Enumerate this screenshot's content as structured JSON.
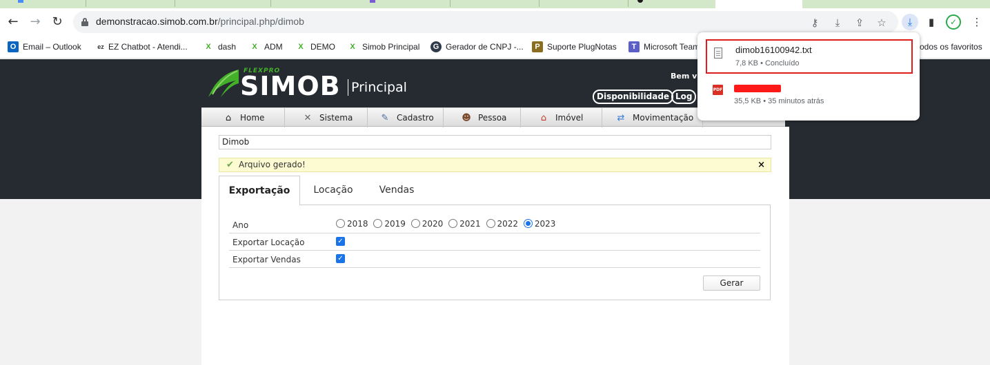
{
  "browser": {
    "url_host": "demonstracao.simob.com.br",
    "url_path": "/principal.php/dimob",
    "icons": [
      "back-icon",
      "forward-icon",
      "reload-icon",
      "lock-icon",
      "key-icon",
      "install-icon",
      "share-icon",
      "star-icon",
      "download-icon",
      "sidebar-icon",
      "menu-icon"
    ]
  },
  "bookmarks": [
    {
      "label": "Email – Outlook",
      "icon": "O"
    },
    {
      "label": "EZ Chatbot - Atendi...",
      "icon": "ez"
    },
    {
      "label": "dash",
      "icon": "X"
    },
    {
      "label": "ADM",
      "icon": "X"
    },
    {
      "label": "DEMO",
      "icon": "X"
    },
    {
      "label": "Simob Principal",
      "icon": "X"
    },
    {
      "label": "Gerador de CNPJ -...",
      "icon": "G"
    },
    {
      "label": "Suporte PlugNotas",
      "icon": "P"
    },
    {
      "label": "Microsoft Team",
      "icon": "T"
    },
    {
      "label": "odos os favoritos",
      "icon": ""
    }
  ],
  "downloads": [
    {
      "name": "dimob16100942.txt",
      "meta": "7,8 KB • Concluído",
      "type": "txt"
    },
    {
      "name": "",
      "meta": "35,5 KB • 35 minutos atrás",
      "type": "pdf"
    }
  ],
  "header": {
    "logo_tagline": "FLEXPRO",
    "logo_name": "SIMOB",
    "logo_section": "Principal",
    "welcome": "Bem v",
    "buttons": [
      "Disponibilidade",
      "Log"
    ]
  },
  "menu": [
    {
      "label": "Home",
      "icon": "home-icon",
      "glyph": "⌂"
    },
    {
      "label": "Sistema",
      "icon": "tools-icon",
      "glyph": "✕"
    },
    {
      "label": "Cadastro",
      "icon": "pen-icon",
      "glyph": "✎"
    },
    {
      "label": "Pessoa",
      "icon": "person-icon",
      "glyph": "☻"
    },
    {
      "label": "Imóvel",
      "icon": "house-icon",
      "glyph": "⌂"
    },
    {
      "label": "Movimentação",
      "icon": "transfer-icon",
      "glyph": "⇄"
    }
  ],
  "breadcrumb": "Dimob",
  "alert": {
    "text": "Arquivo gerado!",
    "close": "×"
  },
  "tabs": [
    {
      "label": "Exportação",
      "active": true
    },
    {
      "label": "Locação",
      "active": false
    },
    {
      "label": "Vendas",
      "active": false
    }
  ],
  "form": {
    "ano_label": "Ano",
    "years": [
      "2018",
      "2019",
      "2020",
      "2021",
      "2022",
      "2023"
    ],
    "selected_year": "2023",
    "exportar_locacao_label": "Exportar Locação",
    "exportar_locacao_checked": true,
    "exportar_vendas_label": "Exportar Vendas",
    "exportar_vendas_checked": true,
    "submit_label": "Gerar"
  },
  "colors": {
    "header_bg": "#262b31",
    "accent_green": "#43b02a",
    "checkbox_blue": "#1a73e8",
    "alert_bg": "#fcfbd1",
    "download_highlight": "#e01b1b"
  }
}
